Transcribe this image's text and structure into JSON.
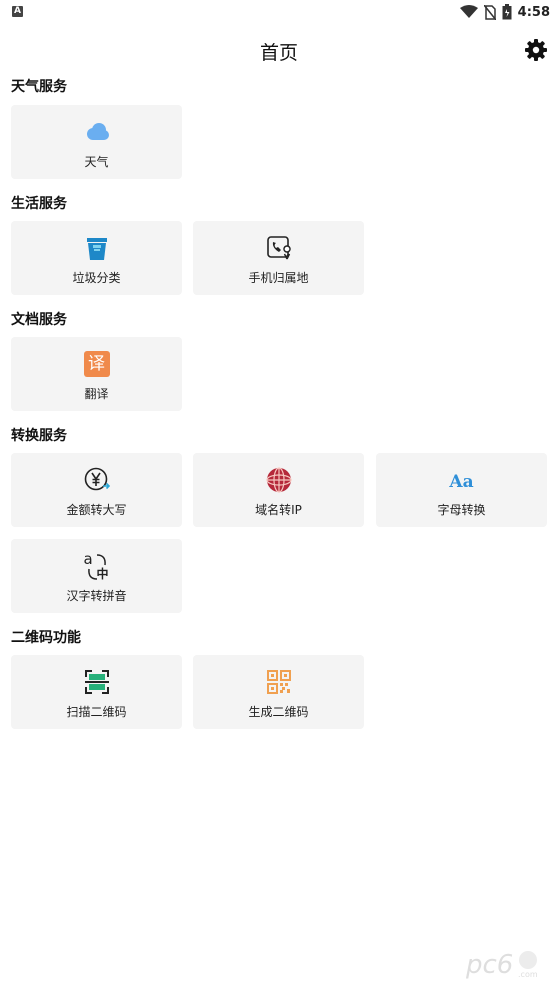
{
  "status_bar": {
    "time": "4:58"
  },
  "header": {
    "title": "首页"
  },
  "sections": [
    {
      "title": "天气服务",
      "items": [
        {
          "label": "天气",
          "icon": "cloud-icon"
        }
      ]
    },
    {
      "title": "生活服务",
      "items": [
        {
          "label": "垃圾分类",
          "icon": "trash-bin-icon"
        },
        {
          "label": "手机归属地",
          "icon": "phone-location-icon"
        }
      ]
    },
    {
      "title": "文档服务",
      "items": [
        {
          "label": "翻译",
          "icon": "translate-icon",
          "glyph": "译"
        }
      ]
    },
    {
      "title": "转换服务",
      "items": [
        {
          "label": "金额转大写",
          "icon": "yuan-convert-icon",
          "glyph": "¥"
        },
        {
          "label": "域名转IP",
          "icon": "globe-icon"
        },
        {
          "label": "字母转换",
          "icon": "letter-case-icon",
          "glyph": "Aa"
        },
        {
          "label": "汉字转拼音",
          "icon": "pinyin-icon",
          "glyph": "a",
          "glyph2": "中"
        }
      ]
    },
    {
      "title": "二维码功能",
      "items": [
        {
          "label": "扫描二维码",
          "icon": "scan-qr-icon"
        },
        {
          "label": "生成二维码",
          "icon": "qr-code-icon"
        }
      ]
    }
  ],
  "colors": {
    "card_bg": "#f4f4f4",
    "cloud": "#6aaef0",
    "trash": "#1e88c8",
    "translate": "#f08a4b",
    "globe": "#b5283a",
    "letter": "#2f8fd8",
    "scan": "#27b07a",
    "qr": "#f0a050"
  }
}
